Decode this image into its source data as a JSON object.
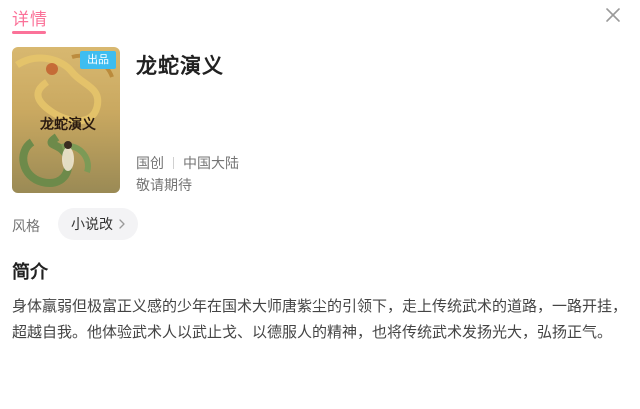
{
  "header": {
    "active_tab": "详情",
    "close_icon": "close-icon",
    "accent_color": "#fb7299"
  },
  "work": {
    "cover_badge": "出品",
    "cover_badge_color": "#3ebdf0",
    "title": "龙蛇演义",
    "meta_type": "国创",
    "meta_region": "中国大陆",
    "status": "敬请期待"
  },
  "style": {
    "label": "风格",
    "tag": "小说改",
    "tag_icon": "chevron-right-icon"
  },
  "intro": {
    "heading": "简介",
    "text": "身体羸弱但极富正义感的少年在国术大师唐紫尘的引领下，走上传统武术的道路，一路开挂，超越自我。他体验武术人以武止戈、以德服人的精神，也将传统武术发扬光大，弘扬正气。"
  }
}
